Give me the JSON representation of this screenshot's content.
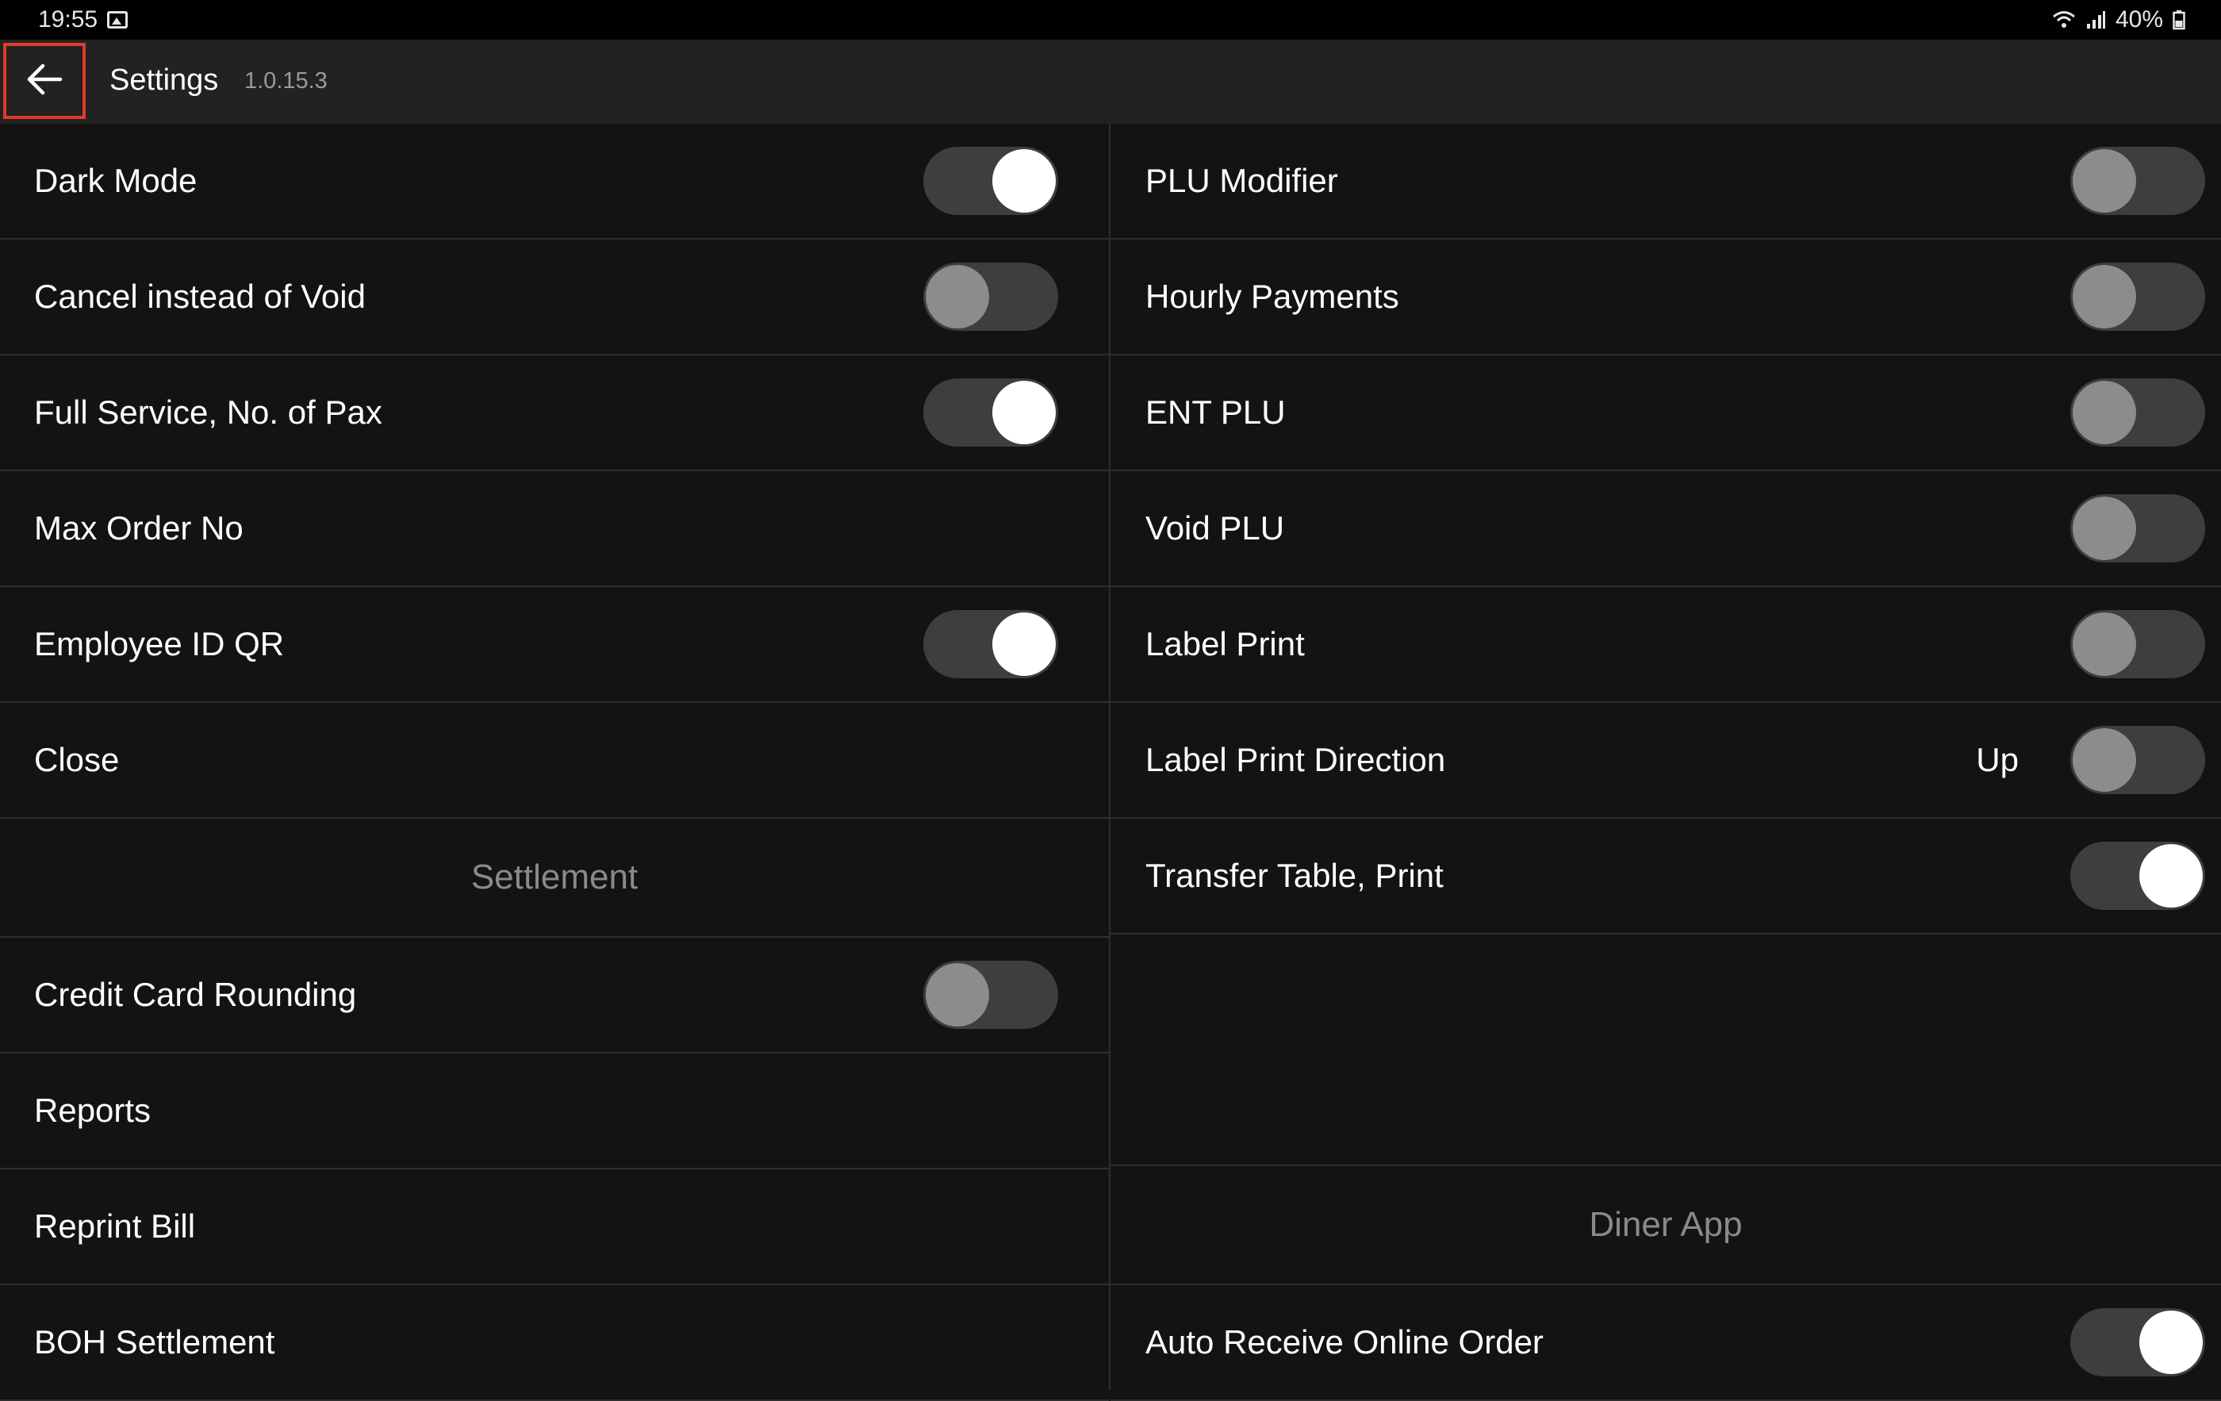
{
  "status_bar": {
    "time": "19:55",
    "battery": "40%",
    "icons": [
      "gallery-icon",
      "wifi-icon",
      "signal-icon",
      "battery-icon"
    ]
  },
  "app_bar": {
    "back_icon": "arrow-left-icon",
    "title": "Settings",
    "version": "1.0.15.3"
  },
  "left_column": {
    "rows": [
      {
        "label": "Dark Mode",
        "toggle": true
      },
      {
        "label": "Cancel instead of Void",
        "toggle": false
      },
      {
        "label": "Full Service, No. of Pax",
        "toggle": true
      },
      {
        "label": "Max Order No"
      },
      {
        "label": "Employee ID QR",
        "toggle": true
      },
      {
        "label": "Close"
      }
    ],
    "section_title": "Settlement",
    "settlement_rows": [
      {
        "label": "Credit Card Rounding",
        "toggle": false
      },
      {
        "label": "Reports"
      },
      {
        "label": "Reprint Bill"
      },
      {
        "label": "BOH Settlement"
      }
    ]
  },
  "right_column": {
    "rows": [
      {
        "label": "PLU Modifier",
        "toggle": false
      },
      {
        "label": "Hourly Payments",
        "toggle": false
      },
      {
        "label": "ENT PLU",
        "toggle": false
      },
      {
        "label": "Void PLU",
        "toggle": false
      },
      {
        "label": "Label Print",
        "toggle": false
      },
      {
        "label": "Label Print Direction",
        "value": "Up",
        "toggle": false
      },
      {
        "label": "Transfer Table, Print",
        "toggle": true
      }
    ],
    "section_title": "Diner App",
    "diner_rows": [
      {
        "label": "Auto Receive Online Order",
        "toggle": true
      }
    ]
  },
  "colors": {
    "background": "#131313",
    "app_bar": "#222222",
    "divider": "#2e2e2e",
    "toggle_track": "#3e3e3e",
    "knob_on": "#ffffff",
    "knob_off": "#8c8c8c",
    "highlight": "#e03a2a",
    "section_text": "#8a8a8a"
  }
}
